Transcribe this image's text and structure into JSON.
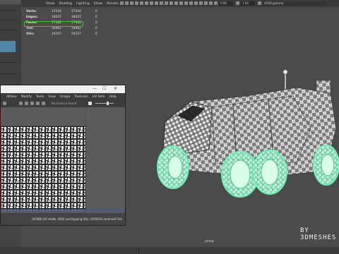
{
  "menubar": {
    "items": [
      "Show",
      "Shading",
      "Lighting",
      "Show",
      "Renderer",
      "Panels"
    ]
  },
  "toolbar": {
    "field_a": "0.00",
    "field_b": "1.00",
    "color_space": "sRGB gamma"
  },
  "poly_count": {
    "rows": [
      {
        "label": "Verts:",
        "a": "17244",
        "b": "17244",
        "c": "0"
      },
      {
        "label": "Edges:",
        "a": "34037",
        "b": "34037",
        "c": "0"
      },
      {
        "label": "Faces:",
        "a": "17462",
        "b": "17462",
        "c": "0"
      },
      {
        "label": "Tris:",
        "a": "34062",
        "b": "34062",
        "c": "0"
      },
      {
        "label": "UVs:",
        "a": "24157",
        "b": "24157",
        "c": "0"
      }
    ]
  },
  "uv_editor": {
    "window_controls": {
      "minimize": "—",
      "maximize": "☐",
      "close": "✕"
    },
    "menu": [
      "ditSee",
      "Modify",
      "Tools",
      "View",
      "Image",
      "Textures",
      "UV Sets",
      "Help"
    ],
    "texture_field": "No texture found",
    "status": "(0/588) UV shells, (0/0) overlapping UVs, (0/0010) reversed UVs"
  },
  "viewport": {
    "camera_label": "persp",
    "watermark": "BY 3DMESHES"
  },
  "colors": {
    "highlight": "#3fbf3f",
    "selection": "#5285a6",
    "wheel_glow": "#6ef0b8"
  }
}
